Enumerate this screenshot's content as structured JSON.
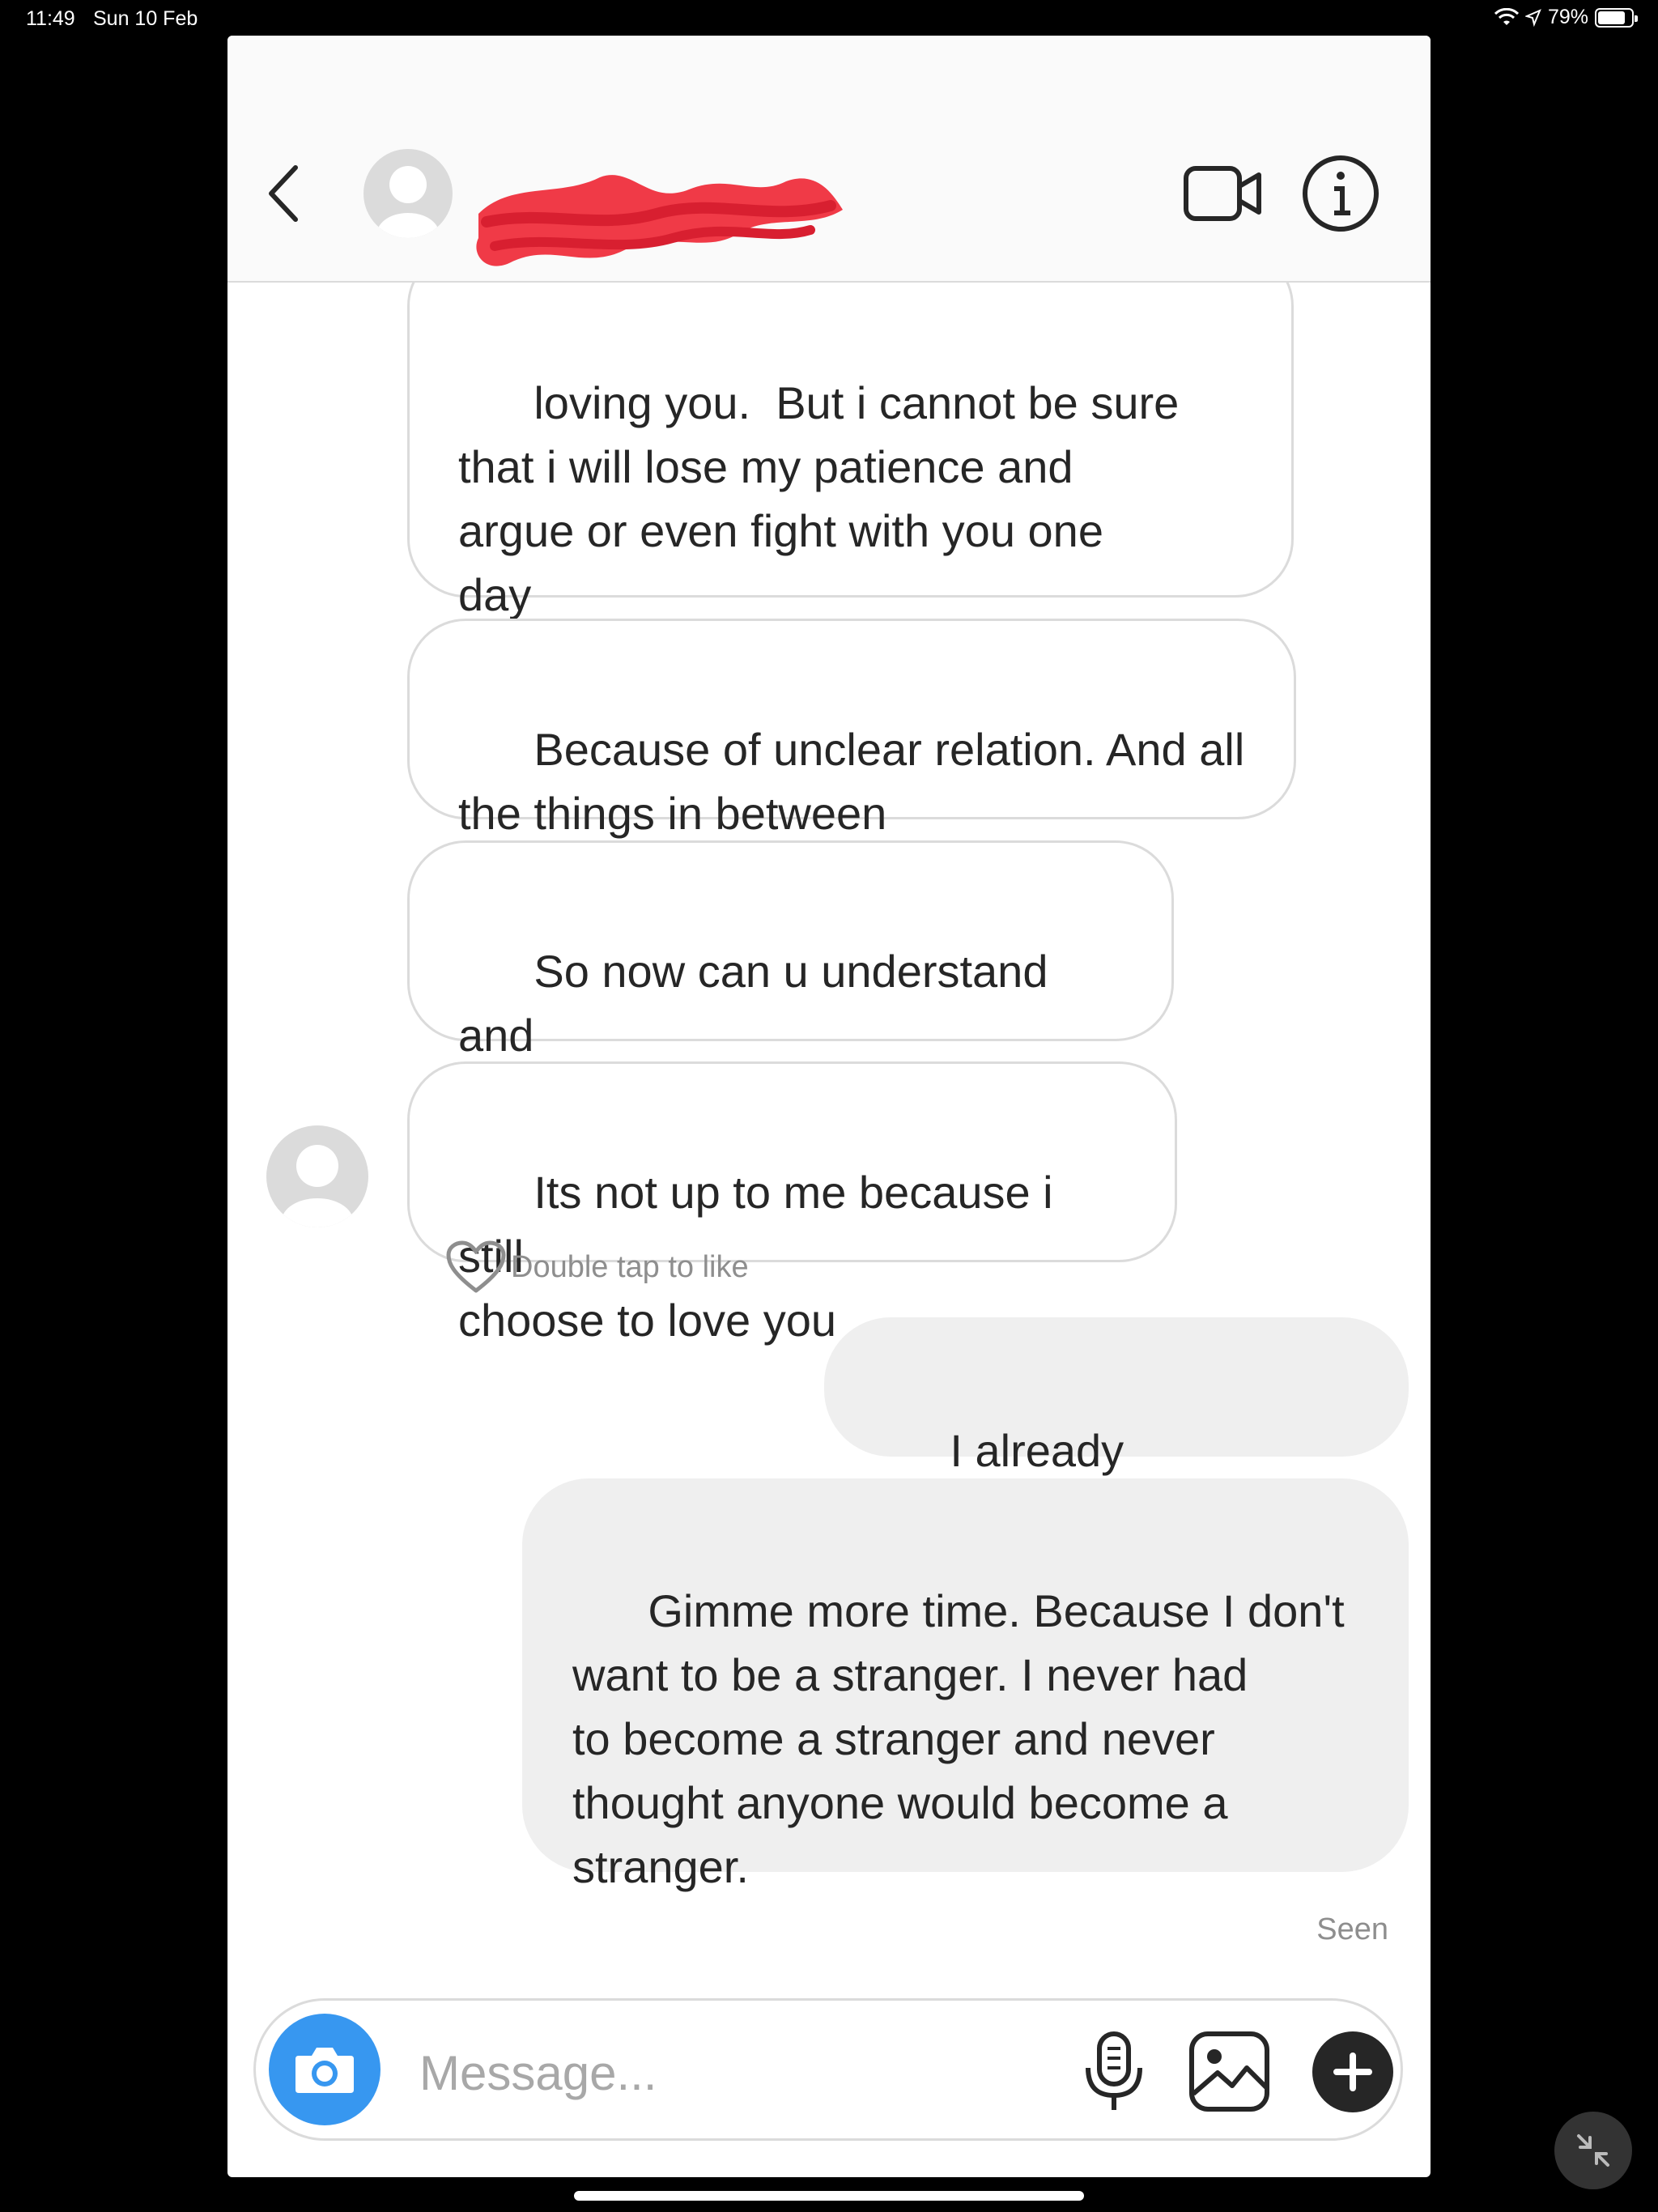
{
  "status_bar": {
    "time": "11:49",
    "date": "Sun 10 Feb",
    "battery": "79%"
  },
  "header": {
    "contact_name": "[redacted]",
    "back_icon": "chevron-left-icon",
    "video_icon": "video-camera-icon",
    "info_icon": "info-icon"
  },
  "messages": [
    {
      "from": "them",
      "text": "loving you.  But i cannot be sure\nthat i will lose my patience and\nargue or even fight with you one\nday"
    },
    {
      "from": "them",
      "text": "Because of unclear relation. And all\nthe things in between"
    },
    {
      "from": "them",
      "text": "So now can u understand and\nchoose"
    },
    {
      "from": "them",
      "text": "Its not up to me because i still\nchoose to love you"
    },
    {
      "from": "me",
      "text": "I already understand."
    },
    {
      "from": "me",
      "text": "Gimme more time. Because I don't\nwant to be a stranger. I never had\nto become a stranger and never\nthought anyone would become a\nstranger."
    }
  ],
  "like_hint": "Double tap to like",
  "seen_label": "Seen",
  "composer": {
    "placeholder": "Message...",
    "accent_color": "#3797f0"
  }
}
